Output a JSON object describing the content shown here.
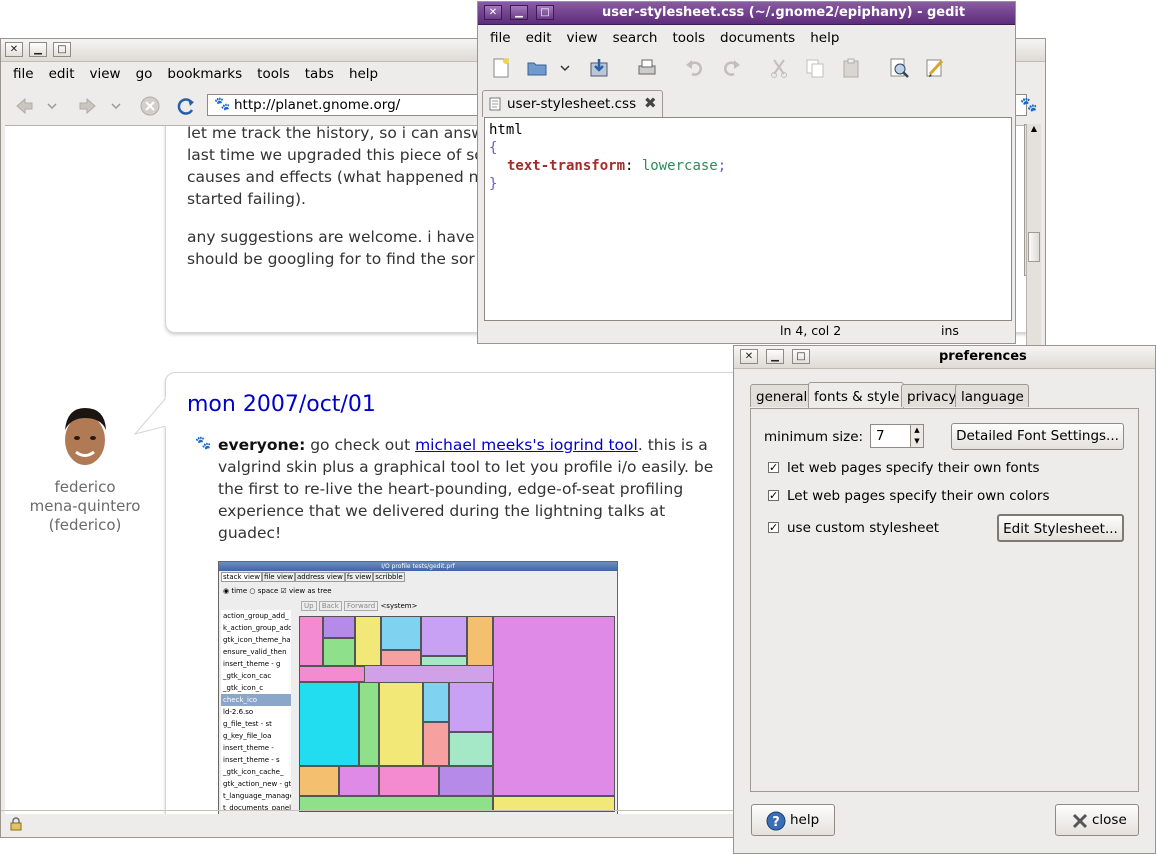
{
  "browser": {
    "menu": [
      "file",
      "edit",
      "view",
      "go",
      "bookmarks",
      "tools",
      "tabs",
      "help"
    ],
    "url": "http://planet.gnome.org/",
    "post1": {
      "lines": [
        "let me track the history, so i can answ",
        "last time we upgraded this piece of so",
        "causes and effects (what happened n",
        "started failing)."
      ],
      "para2": [
        "any suggestions are welcome. i have",
        "should be googling for to find the sor"
      ]
    },
    "post2": {
      "date": "mon 2007/oct/01",
      "author_lines": [
        "federico",
        "mena-quintero",
        "(federico)"
      ],
      "bold_lead": "everyone:",
      "lead_rest": " go check out ",
      "link_text": "michael meeks's iogrind tool",
      "after_link": ". this is a",
      "lines": [
        "valgrind skin plus a graphical tool to let you profile i/o easily. be",
        "the first to re-live the heart-pounding, edge-of-seat profiling",
        "experience that we delivered during the lightning talks at",
        "guadec!"
      ]
    },
    "treemap": {
      "title": "I/O profile tests/gedit.prf",
      "tabs": [
        "stack view",
        "file view",
        "address view",
        "fs view",
        "scribble"
      ],
      "options": [
        "time",
        "space",
        "view as tree"
      ],
      "nav": [
        "Up",
        "Back",
        "Forward"
      ],
      "path": "<system>",
      "tree_items": [
        "action_group_add_",
        "k_action_group_add",
        "gtk_icon_theme_has",
        "ensure_valid_then",
        "insert_theme - g",
        "_gtk_icon_cac",
        "_gtk_icon_c",
        "check_ico",
        "ld-2.6.so",
        "g_file_test - st",
        "g_key_file_loa",
        "insert_theme -",
        "insert_theme - s",
        "_gtk_icon_cache_",
        "gtk_action_new - gtk",
        "t_language_manage",
        "t_documents_panel"
      ]
    }
  },
  "gedit": {
    "title": "user-stylesheet.css (~/.gnome2/epiphany) - gedit",
    "menu": [
      "file",
      "edit",
      "view",
      "search",
      "tools",
      "documents",
      "help"
    ],
    "tab_label": "user-stylesheet.css",
    "code": {
      "selector": "html",
      "open": "{",
      "property": "text-transform",
      "colon": ": ",
      "value": "lowercase",
      "semi": ";",
      "close": "}"
    },
    "status": {
      "position": "ln 4, col 2",
      "mode": "ins"
    }
  },
  "preferences": {
    "title": "preferences",
    "tabs": [
      "general",
      "fonts & style",
      "privacy",
      "language"
    ],
    "min_size_label": "minimum size:",
    "min_size_value": "7",
    "detailed_button": "Detailed Font Settings...",
    "checks": [
      {
        "label": "let web pages specify their own fonts",
        "checked": true
      },
      {
        "label": "Let web pages specify their own colors",
        "checked": true
      },
      {
        "label": "use custom stylesheet",
        "checked": true
      }
    ],
    "edit_button": "Edit Stylesheet...",
    "help_button": "help",
    "close_button": "close"
  }
}
